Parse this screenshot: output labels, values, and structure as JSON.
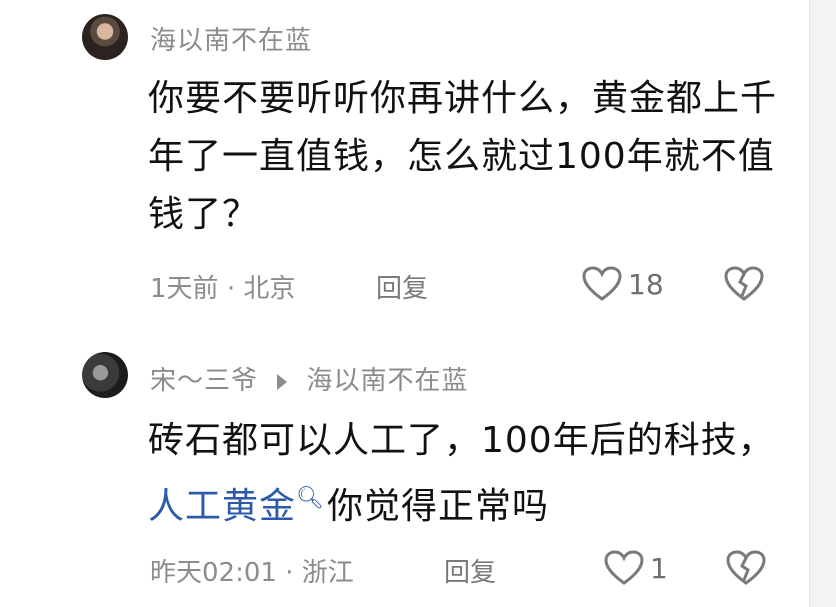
{
  "comments": [
    {
      "username": "海以南不在蓝",
      "text": "你要不要听听你再讲什么，黄金都上千年了一直值钱，怎么就过100年就不值钱了？",
      "time": "1天前",
      "location": "北京",
      "reply_label": "回复",
      "likes": "18"
    },
    {
      "username": "宋～三爷",
      "reply_to": "海以南不在蓝",
      "text_before": "砖石都可以人工了，100年后的科技，",
      "link_text": "人工黄金",
      "text_after": "你觉得正常吗",
      "time": "昨天02:01",
      "location": "浙江",
      "reply_label": "回复",
      "likes": "1"
    }
  ],
  "colors": {
    "link": "#2c5aa8",
    "meta": "#8c8c8c"
  },
  "icons": [
    "avatar",
    "reply-arrow-icon",
    "heart-icon",
    "broken-heart-icon",
    "search-icon"
  ]
}
